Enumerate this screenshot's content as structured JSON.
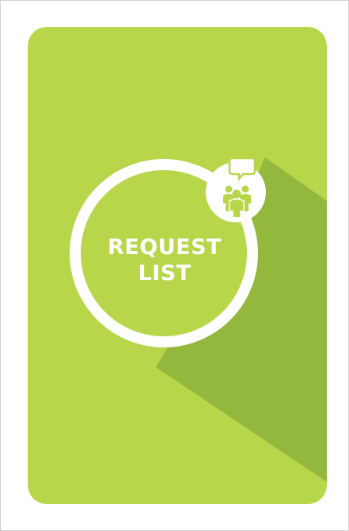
{
  "card": {
    "title_line1": "REQUEST",
    "title_line2": "LIST",
    "icon": "people-chat-icon",
    "colors": {
      "background": "#b7d64a",
      "shadow": "#93b83d",
      "ring": "#ffffff",
      "icon": "#b7d64a"
    }
  }
}
